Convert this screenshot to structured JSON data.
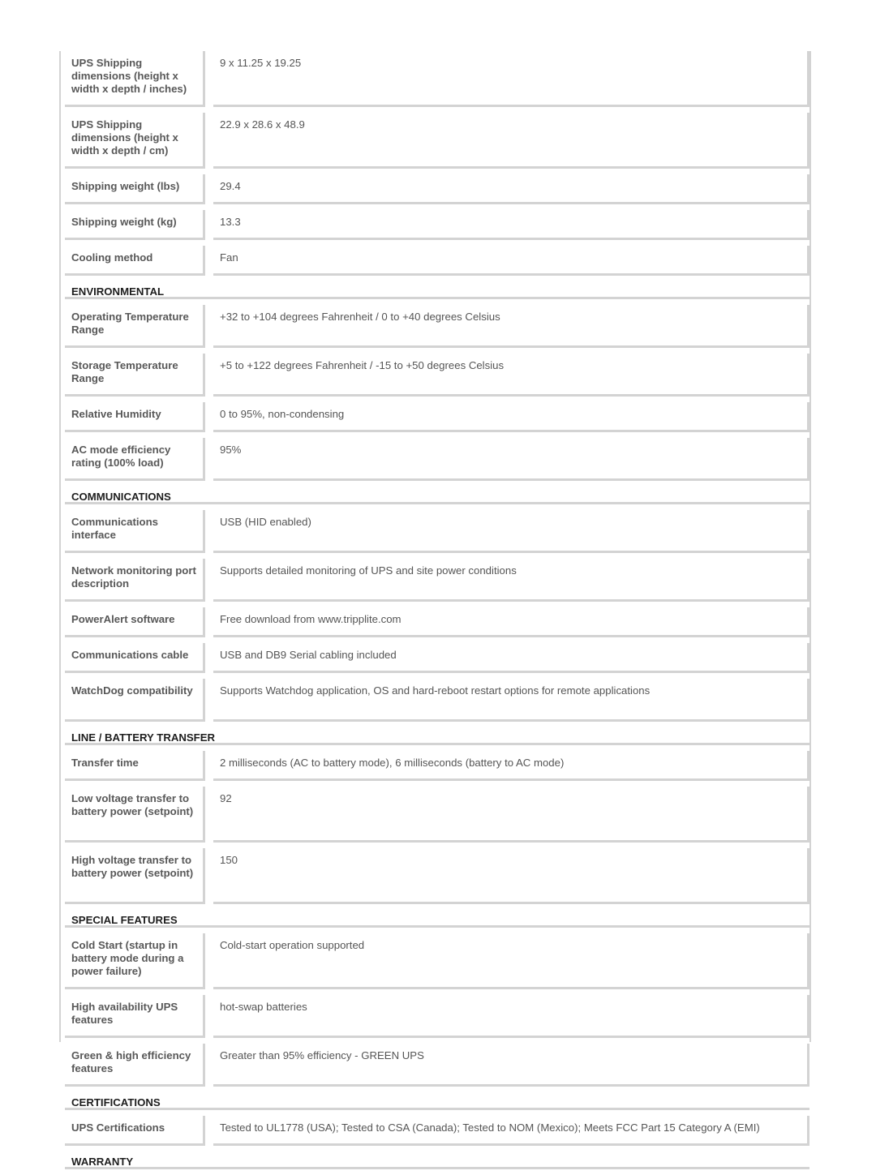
{
  "sections": [
    {
      "title": null,
      "rows": [
        {
          "label": "UPS Shipping dimensions (height x width x depth / inches)",
          "value": "9 x 11.25 x 19.25",
          "lines": 3
        },
        {
          "label": "UPS Shipping dimensions (height x width x depth / cm)",
          "value": "22.9 x 28.6 x 48.9",
          "lines": 3
        },
        {
          "label": "Shipping weight (lbs)",
          "value": "29.4",
          "lines": 1
        },
        {
          "label": "Shipping weight (kg)",
          "value": "13.3",
          "lines": 1
        },
        {
          "label": "Cooling method",
          "value": "Fan",
          "lines": 1
        }
      ]
    },
    {
      "title": "ENVIRONMENTAL",
      "rows": [
        {
          "label": "Operating Temperature Range",
          "value": "+32 to +104 degrees Fahrenheit / 0 to +40 degrees Celsius",
          "lines": 2
        },
        {
          "label": "Storage Temperature Range",
          "value": "+5 to +122 degrees Fahrenheit / -15 to +50 degrees Celsius",
          "lines": 2
        },
        {
          "label": "Relative Humidity",
          "value": "0 to 95%, non-condensing",
          "lines": 1
        },
        {
          "label": "AC mode efficiency rating (100% load)",
          "value": "95%",
          "lines": 2
        }
      ]
    },
    {
      "title": "COMMUNICATIONS",
      "rows": [
        {
          "label": "Communications interface",
          "value": "USB (HID enabled)",
          "lines": 2
        },
        {
          "label": "Network monitoring port description",
          "value": "Supports detailed monitoring of UPS and site power conditions",
          "lines": 2
        },
        {
          "label": "PowerAlert software",
          "value": "Free download from www.tripplite.com",
          "lines": 1
        },
        {
          "label": "Communications cable",
          "value": "USB and DB9 Serial cabling included",
          "lines": 1
        },
        {
          "label": "WatchDog compatibility",
          "value": "Supports Watchdog application, OS and hard-reboot restart options for remote applications",
          "lines": 2
        }
      ]
    },
    {
      "title": "LINE / BATTERY TRANSFER",
      "rows": [
        {
          "label": "Transfer time",
          "value": "2 milliseconds (AC to battery mode), 6 milliseconds (battery to AC mode)",
          "lines": 1
        },
        {
          "label": "Low voltage transfer to battery power (setpoint)",
          "value": "92",
          "lines": 3
        },
        {
          "label": "High voltage transfer to battery power (setpoint)",
          "value": "150",
          "lines": 3
        }
      ]
    },
    {
      "title": "SPECIAL FEATURES",
      "rows": [
        {
          "label": "Cold Start (startup in battery mode during a power failure)",
          "value": "Cold-start operation supported",
          "lines": 3
        },
        {
          "label": "High availability UPS features",
          "value": "hot-swap batteries",
          "lines": 2
        },
        {
          "label": "Green & high efficiency features",
          "value": "Greater than 95% efficiency - GREEN UPS",
          "lines": 2
        }
      ]
    },
    {
      "title": "CERTIFICATIONS",
      "rows": [
        {
          "label": "UPS Certifications",
          "value": "Tested to UL1778 (USA); Tested to CSA (Canada); Tested to NOM (Mexico); Meets FCC Part 15 Category A (EMI)",
          "lines": 1
        }
      ]
    },
    {
      "title": "WARRANTY",
      "rows": []
    }
  ]
}
